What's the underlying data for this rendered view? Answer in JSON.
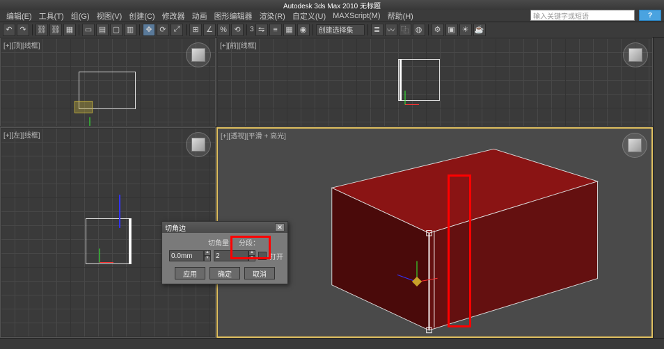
{
  "app": {
    "title": "Autodesk 3ds Max 2010   无标题",
    "search_placeholder": "输入关键字或短语"
  },
  "menu": [
    "编辑(E)",
    "工具(T)",
    "组(G)",
    "视图(V)",
    "创建(C)",
    "修改器",
    "动画",
    "图形编辑器",
    "渲染(R)",
    "自定义(U)",
    "MAXScript(M)",
    "帮助(H)"
  ],
  "toolbar": {
    "combo_label": "创建选择集",
    "numeric": "3"
  },
  "viewports": {
    "top": {
      "label": "[+][顶][线框]"
    },
    "front": {
      "label": "[+][前][线框]"
    },
    "left": {
      "label": "[+][左][线框]"
    },
    "persp": {
      "label": "[+][透视][平滑 + 高光]"
    }
  },
  "dialog": {
    "title": "切角边",
    "chamfer_label": "切角量：",
    "chamfer_value": "0.0mm",
    "segments_label": "分段：",
    "segments_value": "2",
    "open_label": "打开",
    "btn_apply": "应用",
    "btn_ok": "确定",
    "btn_cancel": "取消"
  }
}
